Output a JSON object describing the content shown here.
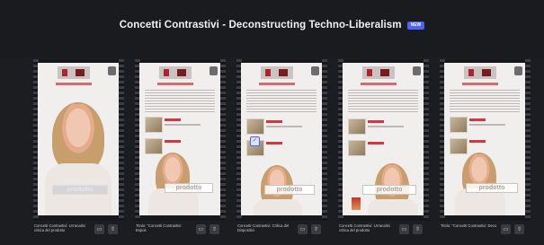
{
  "header": {
    "title": "Concetti Contrastivi - Deconstructing Techno-Liberalism",
    "badge": "NEW"
  },
  "cards": [
    {
      "caption": "prodotto",
      "description": "Concetti Contrastivi: Un'analisi critica del prodotto"
    },
    {
      "caption": "prodotto",
      "description": "Titolo: \"Concetti Contrastivi: Espos"
    },
    {
      "caption": "prodotto",
      "description": "Concetti Contrastivi: Critica del Dispositivi"
    },
    {
      "caption": "prodotto",
      "description": "Concetti Contrastivi: Un'analisi critica del prodotto"
    },
    {
      "caption": "prodotto",
      "description": "Titolo: \"Concetti Contrastivi: Deco"
    }
  ],
  "icons": {
    "caption_button": "closed-caption-icon",
    "share_button": "share-icon"
  },
  "colors": {
    "background": "#1c1d21",
    "badge": "#4d61ff",
    "accent_red": "#cf3a42"
  }
}
